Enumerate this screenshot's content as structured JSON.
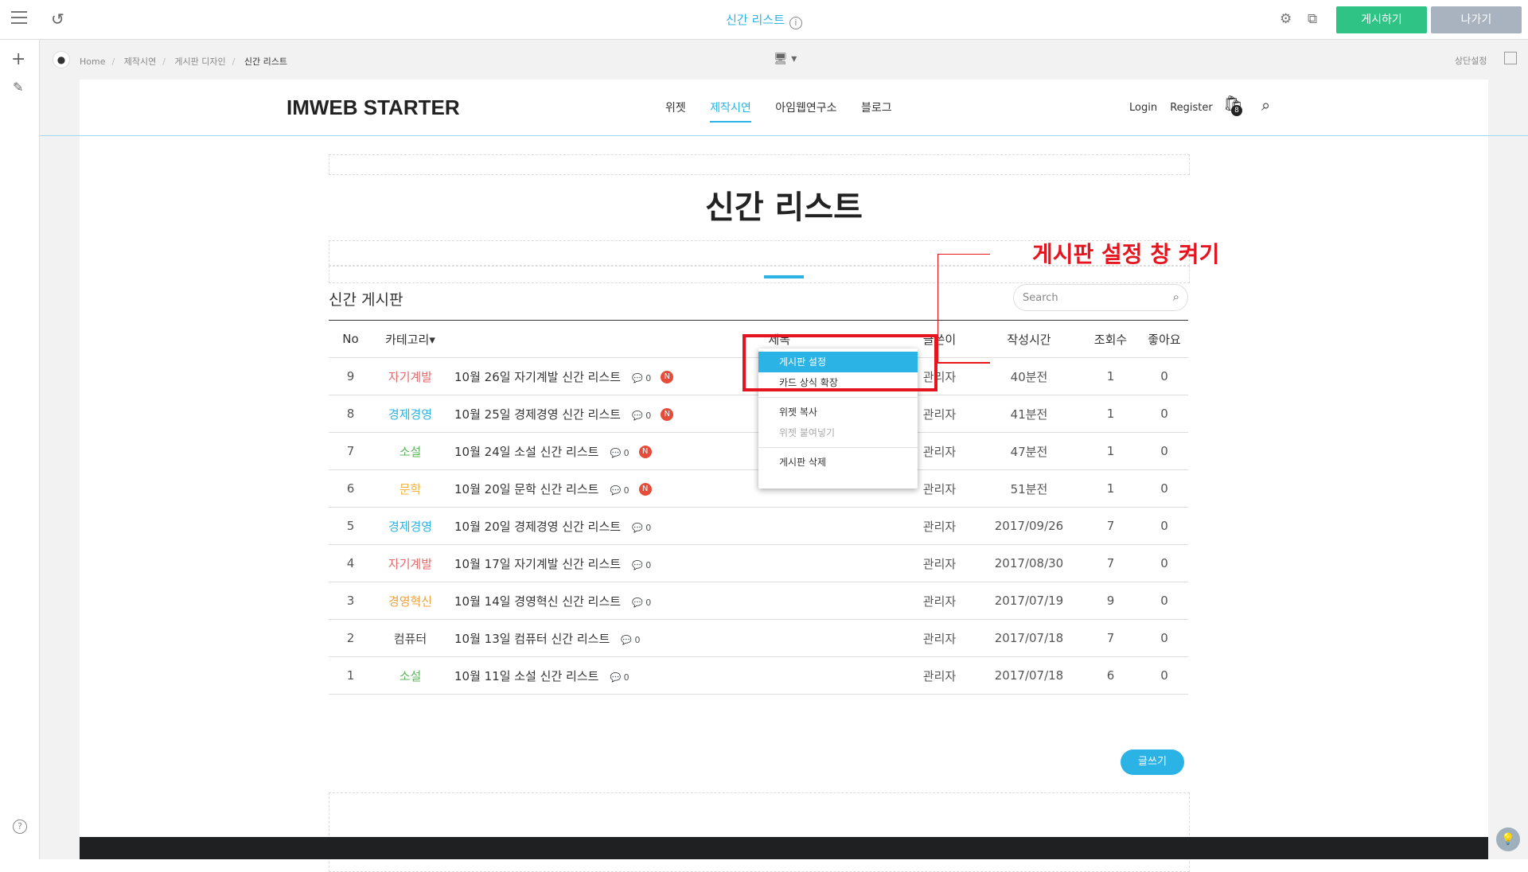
{
  "editor": {
    "page_title": "신간 리스트",
    "publish_label": "게시하기",
    "exit_label": "나가기",
    "top_settings_label": "상단설정",
    "breadcrumb": [
      "Home",
      "제작시연",
      "게시판 디자인",
      "신간 리스트"
    ]
  },
  "site": {
    "logo": "IMWEB STARTER",
    "nav": [
      "위젯",
      "제작시연",
      "아임웹연구소",
      "블로그"
    ],
    "active_nav": "제작시연",
    "login": "Login",
    "register": "Register",
    "cart_count": "8",
    "heading": "신간 리스트"
  },
  "board": {
    "title": "신간 게시판",
    "search_placeholder": "Search",
    "headers": {
      "no": "No",
      "category": "카테고리",
      "subject": "제목",
      "author": "글쓴이",
      "time": "작성시간",
      "views": "조회수",
      "likes": "좋아요"
    },
    "rows": [
      {
        "no": "9",
        "cat": "자기계발",
        "cat_color": "#e56a6a",
        "title": "10월 26일 자기계발 신간 리스트",
        "comments": "0",
        "new": true,
        "author": "관리자",
        "time": "40분전",
        "views": "1",
        "likes": "0"
      },
      {
        "no": "8",
        "cat": "경제경영",
        "cat_color": "#2bb3e6",
        "title": "10월 25일 경제경영 신간 리스트",
        "comments": "0",
        "new": true,
        "author": "관리자",
        "time": "41분전",
        "views": "1",
        "likes": "0"
      },
      {
        "no": "7",
        "cat": "소설",
        "cat_color": "#5cb85c",
        "title": "10월 24일 소설 신간 리스트",
        "comments": "0",
        "new": true,
        "author": "관리자",
        "time": "47분전",
        "views": "1",
        "likes": "0"
      },
      {
        "no": "6",
        "cat": "문학",
        "cat_color": "#f0b43c",
        "title": "10월 20일 문학 신간 리스트",
        "comments": "0",
        "new": true,
        "author": "관리자",
        "time": "51분전",
        "views": "1",
        "likes": "0"
      },
      {
        "no": "5",
        "cat": "경제경영",
        "cat_color": "#2bb3e6",
        "title": "10월 20일 경제경영 신간 리스트",
        "comments": "0",
        "new": false,
        "author": "관리자",
        "time": "2017/09/26",
        "views": "7",
        "likes": "0"
      },
      {
        "no": "4",
        "cat": "자기계발",
        "cat_color": "#e56a6a",
        "title": "10월 17일 자기계발 신간 리스트",
        "comments": "0",
        "new": false,
        "author": "관리자",
        "time": "2017/08/30",
        "views": "7",
        "likes": "0"
      },
      {
        "no": "3",
        "cat": "경영혁신",
        "cat_color": "#f0a03c",
        "title": "10월 14일 경영혁신 신간 리스트",
        "comments": "0",
        "new": false,
        "author": "관리자",
        "time": "2017/07/19",
        "views": "9",
        "likes": "0"
      },
      {
        "no": "2",
        "cat": "컴퓨터",
        "cat_color": "#444444",
        "title": "10월 13일 컴퓨터 신간 리스트",
        "comments": "0",
        "new": false,
        "author": "관리자",
        "time": "2017/07/18",
        "views": "7",
        "likes": "0"
      },
      {
        "no": "1",
        "cat": "소설",
        "cat_color": "#5cb85c",
        "title": "10월 11일 소설 신간 리스트",
        "comments": "0",
        "new": false,
        "author": "관리자",
        "time": "2017/07/18",
        "views": "6",
        "likes": "0"
      }
    ],
    "write_label": "글쓰기",
    "new_badge": "N"
  },
  "context_menu": {
    "items": [
      "게시판 설정",
      "카드 상식 확장",
      "위젯 복사",
      "위젯 붙여넣기",
      "게시판 삭제"
    ]
  },
  "annotation": "게시판 설정 창 켜기",
  "icons": {
    "menu": "hamburger-icon",
    "undo": "undo-icon",
    "info": "info-icon",
    "settings": "gear-icon",
    "external": "external-link-icon",
    "add": "plus-icon",
    "pin": "pin-icon",
    "help": "help-icon",
    "device": "desktop-icon",
    "cart": "cart-icon",
    "search": "search-icon",
    "comment": "comment-icon",
    "bulb": "lightbulb-icon"
  }
}
